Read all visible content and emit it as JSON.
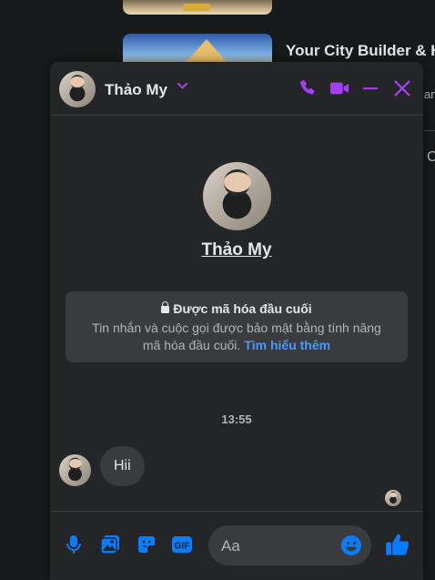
{
  "background": {
    "feed_title": "Your City Builder & H",
    "feed_subtitle": "am",
    "feed_char": "C"
  },
  "chat": {
    "contact_name": "Thảo My",
    "header_icons": [
      "phone-icon",
      "video-icon",
      "minimize-icon",
      "close-icon"
    ],
    "accent_color": "#a33ff0",
    "profile_name": "Thảo My",
    "e2e": {
      "title": "Được mã hóa đầu cuối",
      "body": "Tin nhắn và cuộc gọi được bảo mật bằng tính năng mã hóa đầu cuối.",
      "link": "Tìm hiểu thêm"
    },
    "timestamp": "13:55",
    "messages": [
      {
        "from": "Thảo My",
        "text": "Hii"
      }
    ],
    "composer": {
      "placeholder": "Aa",
      "icons": [
        "microphone-icon",
        "photo-icon",
        "sticker-icon",
        "gif-icon",
        "emoji-icon",
        "like-icon"
      ],
      "icon_color": "#0a7cff"
    }
  }
}
